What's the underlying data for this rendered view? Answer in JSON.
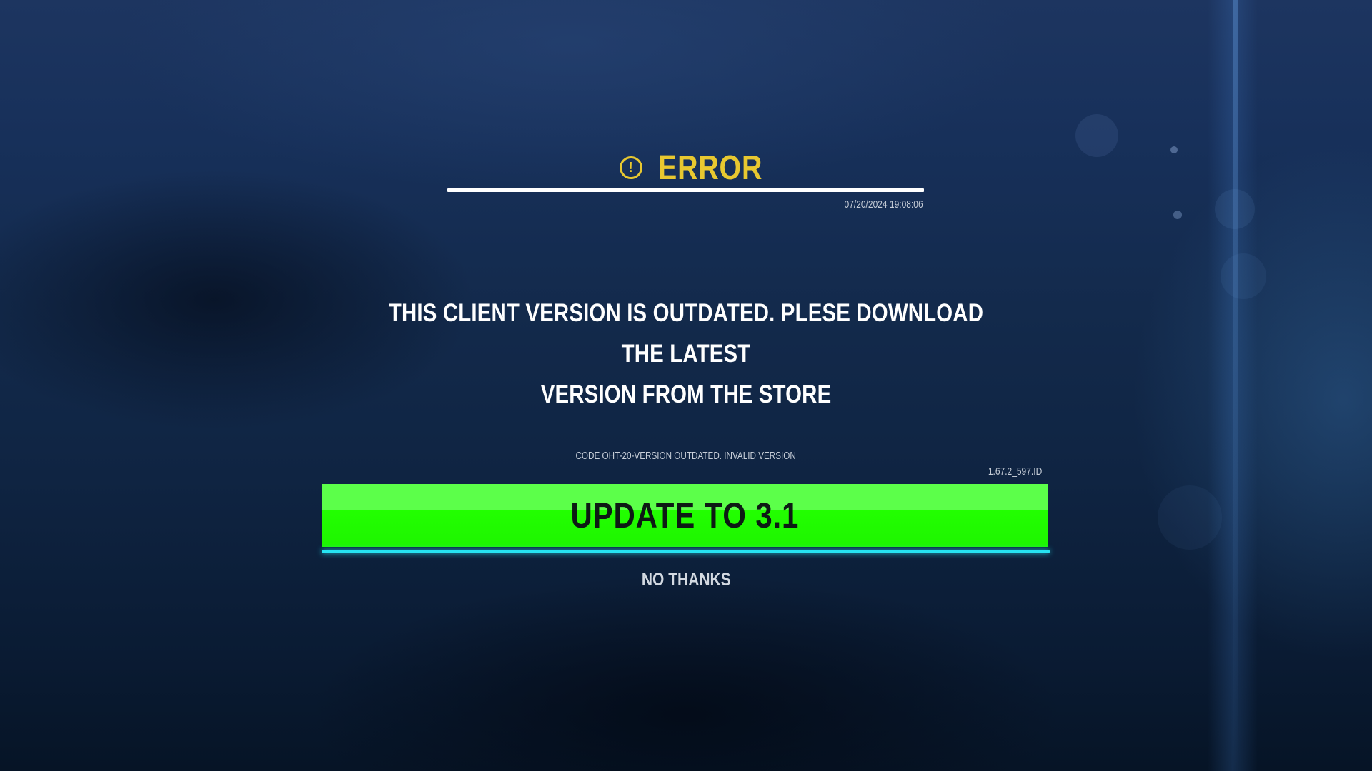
{
  "dialog": {
    "title": "ERROR",
    "icon": "exclamation-circle-icon",
    "timestamp": "07/20/2024 19:08:06",
    "message_line1": "THIS CLIENT VERSION IS OUTDATED. PLESE DOWNLOAD THE LATEST",
    "message_line2": "VERSION FROM THE STORE",
    "error_code": "CODE OHT-20-VERSION OUTDATED. INVALID VERSION",
    "version": "1.67.2_597.ID",
    "update_button_label": "UPDATE TO 3.1",
    "dismiss_label": "NO THANKS"
  },
  "colors": {
    "accent_title": "#e8c830",
    "button_green": "#22ff00",
    "button_underline": "#26e3f2",
    "background": "#132a4c"
  }
}
